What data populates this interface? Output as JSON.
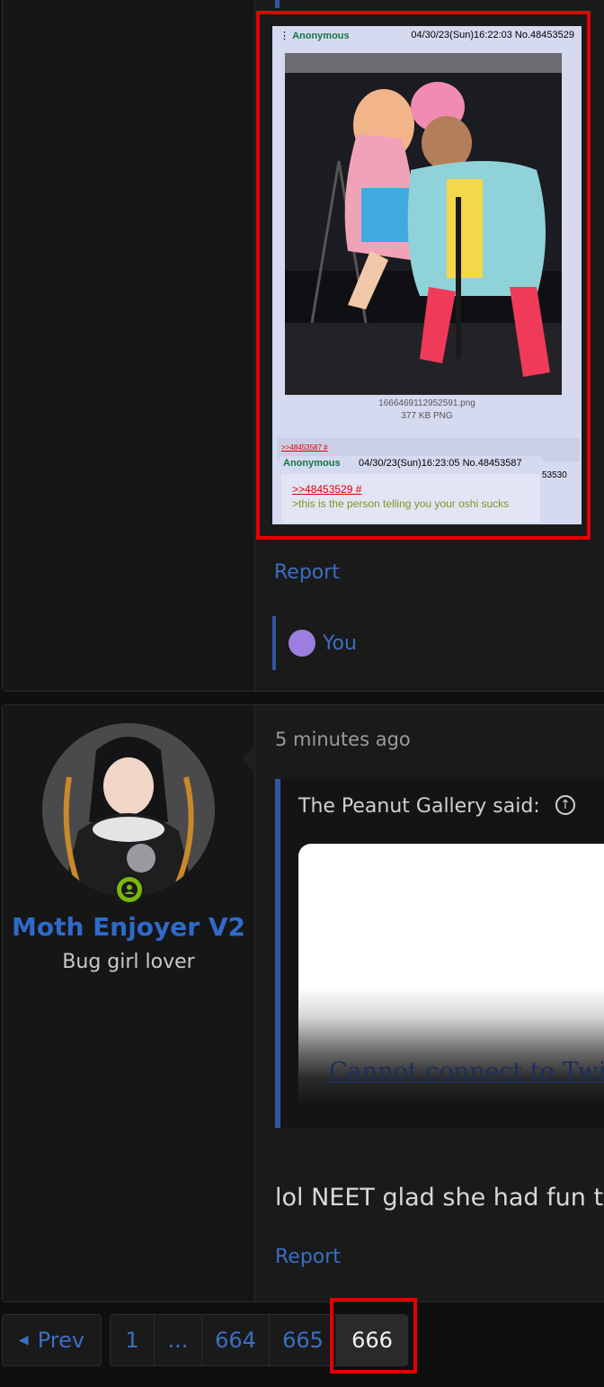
{
  "post1": {
    "screenshot": {
      "op_name": "Anonymous",
      "op_datetime": "04/30/23(Sun)16:22:03 No.48453529",
      "menu_glyph": "⋮",
      "file_name": "1666469112952591.png",
      "file_info": "377 KB PNG",
      "backlink": ">>48453587 #",
      "side_cut_text": "53530",
      "reply_name": "Anonymous",
      "reply_datetime": "04/30/23(Sun)16:23:05 No.48453587",
      "reply_quote": ">>48453529 #",
      "reply_greentext": ">this is the person telling you your oshi sucks"
    },
    "report_label": "Report",
    "reaction_user": "You"
  },
  "post2": {
    "username": "Moth Enjoyer V2",
    "user_title": "Bug girl lover",
    "time_ago": "5 minutes ago",
    "quote_author_said": "The Peanut Gallery said:",
    "embed_error": "Cannot connect to Twitt",
    "message": "lol NEET glad she had fun th",
    "report_label": "Report"
  },
  "pagination": {
    "prev_label": "Prev",
    "pages": [
      "1",
      "...",
      "664",
      "665",
      "666"
    ],
    "current": "666"
  },
  "colors": {
    "link": "#3b6fbf",
    "highlight_box": "#e40000",
    "chan_bg": "#d6daf0",
    "online": "#7ab80e"
  }
}
